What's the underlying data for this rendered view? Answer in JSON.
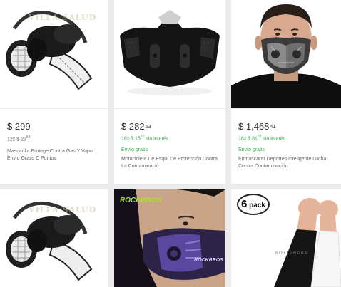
{
  "listings": [
    {
      "price_symbol": "$",
      "price_int": "299",
      "price_cents": "",
      "installments_text": "12x $ 29",
      "installments_cents": "54",
      "installments_suffix": "",
      "installments_free": false,
      "free_shipping": "",
      "title": "Mascarilla Protege Contra Gas Y Vapor Envio Gratis C Puritos",
      "image_icon": "gas-respirator-image",
      "watermark": "VILLA SALUD"
    },
    {
      "price_symbol": "$",
      "price_int": "282",
      "price_cents": "53",
      "installments_text": "18x $ 15",
      "installments_cents": "70",
      "installments_suffix": " sin interés",
      "installments_free": true,
      "free_shipping": "Envío gratis",
      "title": "Motocicleta De Esquí De Protección Contra La Contaminació",
      "image_icon": "black-face-mask-image"
    },
    {
      "price_symbol": "$",
      "price_int": "1,468",
      "price_cents": "41",
      "installments_text": "18x $ 81",
      "installments_cents": "58",
      "installments_suffix": " sin interés",
      "installments_free": true,
      "free_shipping": "Envío gratis",
      "title": "Enmascarar Deportes Inteligente Lucha Contra Contaminación",
      "image_icon": "man-wearing-sport-mask-image"
    },
    {
      "image_icon": "gas-respirator-image",
      "watermark": "VILLA SALUD"
    },
    {
      "image_icon": "rockbros-purple-mask-image",
      "brand": "ROCKBROS",
      "brand2": "ROCKBROS"
    },
    {
      "image_icon": "arm-sleeves-image",
      "badge_num": "6",
      "badge_word": "pack",
      "brand": "KOTTERDAM"
    }
  ],
  "colors": {
    "background": "#ebebeb",
    "card": "#ffffff",
    "free_green": "#39b54a",
    "text": "#333333"
  }
}
